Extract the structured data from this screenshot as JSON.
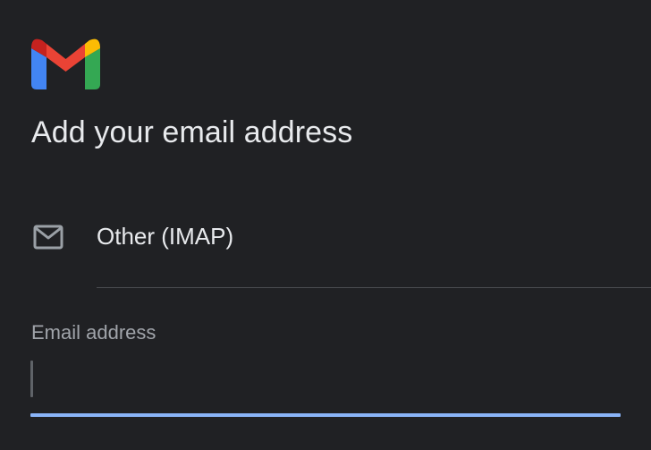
{
  "header": {
    "logo_icon": "gmail-logo-icon",
    "title": "Add your email address"
  },
  "provider": {
    "icon": "mail-envelope-icon",
    "label": "Other (IMAP)"
  },
  "email_field": {
    "label": "Email address",
    "value": "",
    "accent_color": "#8ab4f8"
  },
  "colors": {
    "background": "#202124",
    "text": "#e8eaed",
    "muted_text": "#a0a4aa",
    "divider": "#4a4c50"
  }
}
